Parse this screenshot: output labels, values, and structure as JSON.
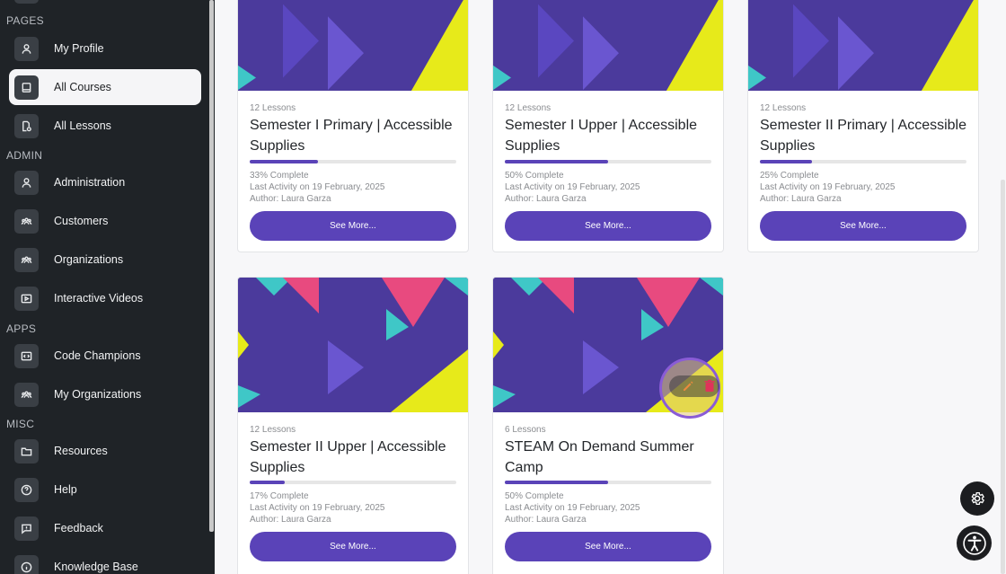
{
  "sidebar": {
    "sections": [
      {
        "label": "PAGES"
      },
      {
        "label": "ADMIN"
      },
      {
        "label": "APPS"
      },
      {
        "label": "MISC"
      }
    ],
    "items": [
      {
        "label": "My Profile",
        "icon": "user-icon"
      },
      {
        "label": "All Courses",
        "icon": "book-icon",
        "active": true
      },
      {
        "label": "All Lessons",
        "icon": "lesson-icon"
      },
      {
        "label": "Administration",
        "icon": "user-icon"
      },
      {
        "label": "Customers",
        "icon": "group-icon"
      },
      {
        "label": "Organizations",
        "icon": "group-icon"
      },
      {
        "label": "Interactive Videos",
        "icon": "video-icon"
      },
      {
        "label": "Code Champions",
        "icon": "code-icon"
      },
      {
        "label": "My Organizations",
        "icon": "group-icon"
      },
      {
        "label": "Resources",
        "icon": "folder-icon"
      },
      {
        "label": "Help",
        "icon": "help-icon"
      },
      {
        "label": "Feedback",
        "icon": "feedback-icon"
      },
      {
        "label": "Knowledge Base",
        "icon": "info-icon"
      }
    ]
  },
  "courses": [
    {
      "lessons": "12 Lessons",
      "title": "Semester I Primary | Accessible Supplies",
      "progress": 0.33,
      "complete": "33% Complete",
      "activity": "Last Activity on 19 February, 2025",
      "author": "Author: Laura Garza",
      "button": "See More..."
    },
    {
      "lessons": "12 Lessons",
      "title": "Semester I Upper | Accessible Supplies",
      "progress": 0.5,
      "complete": "50% Complete",
      "activity": "Last Activity on 19 February, 2025",
      "author": "Author: Laura Garza",
      "button": "See More..."
    },
    {
      "lessons": "12 Lessons",
      "title": "Semester II Primary | Accessible Supplies",
      "progress": 0.25,
      "complete": "25% Complete",
      "activity": "Last Activity on 19 February, 2025",
      "author": "Author: Laura Garza",
      "button": "See More..."
    },
    {
      "lessons": "12 Lessons",
      "title": "Semester II Upper | Accessible Supplies",
      "progress": 0.17,
      "complete": "17% Complete",
      "activity": "Last Activity on 19 February, 2025",
      "author": "Author: Laura Garza",
      "button": "See More..."
    },
    {
      "lessons": "6 Lessons",
      "title": "STEAM On Demand Summer Camp",
      "progress": 0.5,
      "complete": "50% Complete",
      "activity": "Last Activity on 19 February, 2025",
      "author": "Author: Laura Garza",
      "button": "See More..."
    }
  ],
  "colors": {
    "accent": "#5a43b8",
    "sidebar": "#1f2327",
    "delete": "#e0335a"
  },
  "floating": {
    "settings_icon": "gear-icon",
    "accessibility_icon": "accessibility-icon"
  }
}
